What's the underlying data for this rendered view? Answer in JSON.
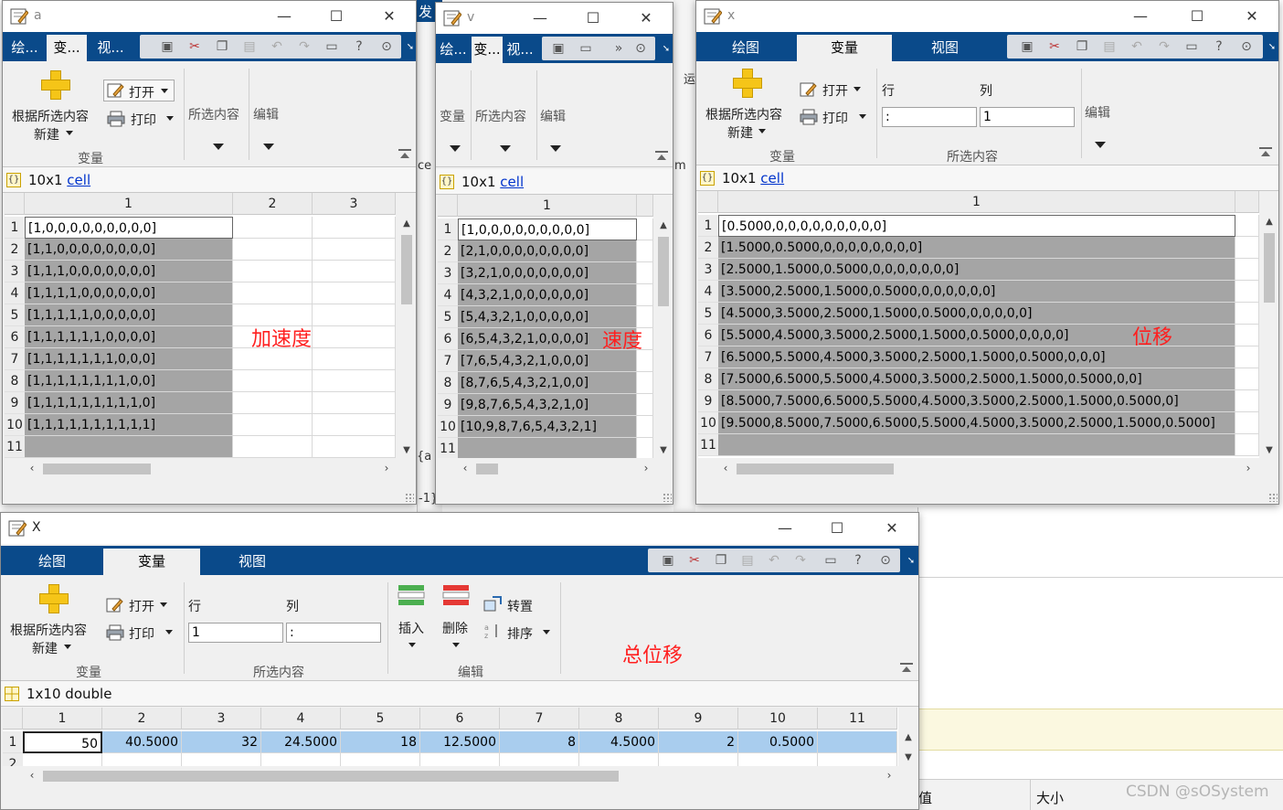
{
  "colors": {
    "tabbar": "#0a4a8a",
    "selected_cell": "#a5a5a5",
    "selected_row_blue": "#a9cdee",
    "annotation": "#ff2020",
    "link": "#0033cc"
  },
  "background": {
    "fragments": [
      "发",
      "ce",
      "m",
      "运",
      "{a",
      "-1}",
      "1)",
      "值",
      "大小"
    ],
    "watermark": "CSDN @sOSystem"
  },
  "icons": [
    "variable-editor-icon",
    "minimize-icon",
    "maximize-icon",
    "close-icon",
    "save-icon",
    "cut-icon",
    "copy-icon",
    "paste-icon",
    "undo-icon",
    "redo-icon",
    "window-icon",
    "help-icon",
    "options-icon",
    "plus-icon",
    "open-icon",
    "print-icon",
    "cell-icon",
    "matrix-icon",
    "insert-icon",
    "delete-icon",
    "transpose-icon",
    "sort-icon"
  ],
  "window_a": {
    "title": "a",
    "tabs": [
      "绘...",
      "变...",
      "视..."
    ],
    "ribbon": {
      "new_from_selection": "根据所选内容",
      "new": "新建",
      "open": "打开",
      "print": "打印",
      "selection": "所选内容",
      "edit": "编辑",
      "variable_group": "变量"
    },
    "info": {
      "size": "10x1",
      "type": "cell"
    },
    "columns": [
      "1",
      "2",
      "3"
    ],
    "rows": [
      {
        "n": "1",
        "v": "[1,0,0,0,0,0,0,0,0,0]"
      },
      {
        "n": "2",
        "v": "[1,1,0,0,0,0,0,0,0,0]"
      },
      {
        "n": "3",
        "v": "[1,1,1,0,0,0,0,0,0,0]"
      },
      {
        "n": "4",
        "v": "[1,1,1,1,0,0,0,0,0,0]"
      },
      {
        "n": "5",
        "v": "[1,1,1,1,1,0,0,0,0,0]"
      },
      {
        "n": "6",
        "v": "[1,1,1,1,1,1,0,0,0,0]"
      },
      {
        "n": "7",
        "v": "[1,1,1,1,1,1,1,0,0,0]"
      },
      {
        "n": "8",
        "v": "[1,1,1,1,1,1,1,1,0,0]"
      },
      {
        "n": "9",
        "v": "[1,1,1,1,1,1,1,1,1,0]"
      },
      {
        "n": "10",
        "v": "[1,1,1,1,1,1,1,1,1,1]"
      },
      {
        "n": "11",
        "v": ""
      }
    ],
    "annotation": "加速度"
  },
  "window_v": {
    "title": "v",
    "tabs": [
      "绘...",
      "变...",
      "视..."
    ],
    "ribbon": {
      "variable": "变量",
      "selection": "所选内容",
      "edit": "编辑"
    },
    "info": {
      "size": "10x1",
      "type": "cell"
    },
    "columns": [
      "1"
    ],
    "rows": [
      {
        "n": "1",
        "v": "[1,0,0,0,0,0,0,0,0,0]"
      },
      {
        "n": "2",
        "v": "[2,1,0,0,0,0,0,0,0,0]"
      },
      {
        "n": "3",
        "v": "[3,2,1,0,0,0,0,0,0,0]"
      },
      {
        "n": "4",
        "v": "[4,3,2,1,0,0,0,0,0,0]"
      },
      {
        "n": "5",
        "v": "[5,4,3,2,1,0,0,0,0,0]"
      },
      {
        "n": "6",
        "v": "[6,5,4,3,2,1,0,0,0,0]"
      },
      {
        "n": "7",
        "v": "[7,6,5,4,3,2,1,0,0,0]"
      },
      {
        "n": "8",
        "v": "[8,7,6,5,4,3,2,1,0,0]"
      },
      {
        "n": "9",
        "v": "[9,8,7,6,5,4,3,2,1,0]"
      },
      {
        "n": "10",
        "v": "[10,9,8,7,6,5,4,3,2,1]"
      },
      {
        "n": "11",
        "v": ""
      }
    ],
    "annotation": "速度"
  },
  "window_x": {
    "title": "x",
    "tabs": [
      "绘图",
      "变量",
      "视图"
    ],
    "ribbon": {
      "new_from_selection": "根据所选内容",
      "new": "新建",
      "open": "打开",
      "print": "打印",
      "row": "行",
      "col": "列",
      "row_value": ":",
      "col_value": "1",
      "edit": "编辑",
      "variable_group": "变量",
      "selection_group": "所选内容"
    },
    "info": {
      "size": "10x1",
      "type": "cell"
    },
    "columns": [
      "1"
    ],
    "rows": [
      {
        "n": "1",
        "v": "[0.5000,0,0,0,0,0,0,0,0,0]"
      },
      {
        "n": "2",
        "v": "[1.5000,0.5000,0,0,0,0,0,0,0,0]"
      },
      {
        "n": "3",
        "v": "[2.5000,1.5000,0.5000,0,0,0,0,0,0,0]"
      },
      {
        "n": "4",
        "v": "[3.5000,2.5000,1.5000,0.5000,0,0,0,0,0,0]"
      },
      {
        "n": "5",
        "v": "[4.5000,3.5000,2.5000,1.5000,0.5000,0,0,0,0,0]"
      },
      {
        "n": "6",
        "v": "[5.5000,4.5000,3.5000,2.5000,1.5000,0.5000,0,0,0,0]"
      },
      {
        "n": "7",
        "v": "[6.5000,5.5000,4.5000,3.5000,2.5000,1.5000,0.5000,0,0,0]"
      },
      {
        "n": "8",
        "v": "[7.5000,6.5000,5.5000,4.5000,3.5000,2.5000,1.5000,0.5000,0,0]"
      },
      {
        "n": "9",
        "v": "[8.5000,7.5000,6.5000,5.5000,4.5000,3.5000,2.5000,1.5000,0.5000,0]"
      },
      {
        "n": "10",
        "v": "[9.5000,8.5000,7.5000,6.5000,5.5000,4.5000,3.5000,2.5000,1.5000,0.5000]"
      },
      {
        "n": "11",
        "v": ""
      }
    ],
    "annotation": "位移"
  },
  "window_X": {
    "title": "X",
    "tabs": [
      "绘图",
      "变量",
      "视图"
    ],
    "ribbon": {
      "new_from_selection": "根据所选内容",
      "new": "新建",
      "open": "打开",
      "print": "打印",
      "row": "行",
      "col": "列",
      "row_value": "1",
      "col_value": ":",
      "insert": "插入",
      "delete": "删除",
      "transpose": "转置",
      "sort": "排序",
      "variable_group": "变量",
      "selection_group": "所选内容",
      "edit_group": "编辑"
    },
    "info": {
      "size": "1x10",
      "type": "double"
    },
    "columns": [
      "1",
      "2",
      "3",
      "4",
      "5",
      "6",
      "7",
      "8",
      "9",
      "10",
      "11"
    ],
    "row_labels": [
      "1",
      "2"
    ],
    "values": [
      "50",
      "40.5000",
      "32",
      "24.5000",
      "18",
      "12.5000",
      "8",
      "4.5000",
      "2",
      "0.5000",
      ""
    ],
    "annotation": "总位移"
  }
}
